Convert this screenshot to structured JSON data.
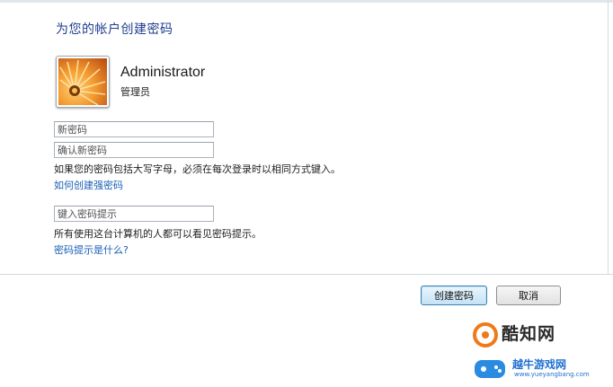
{
  "dialog": {
    "title": "为您的帐户创建密码",
    "account": {
      "name": "Administrator",
      "role": "管理员"
    },
    "fields": {
      "new_password_placeholder": "新密码",
      "confirm_password_placeholder": "确认新密码",
      "hint_placeholder": "键入密码提示"
    },
    "case_note": "如果您的密码包括大写字母，必须在每次登录时以相同方式键入。",
    "strong_password_link": "如何创建强密码",
    "hint_note": "所有使用这台计算机的人都可以看见密码提示。",
    "hint_help_link": "密码提示是什么?",
    "buttons": {
      "create": "创建密码",
      "cancel": "取消"
    }
  },
  "watermark": {
    "logo_text": "酷知网",
    "site_name": "越牛游戏网",
    "url": "www.yueyangbang.com"
  },
  "colors": {
    "title": "#1e3d8f",
    "link": "#1a5fb4",
    "default_button_border": "#3c7fb1"
  }
}
